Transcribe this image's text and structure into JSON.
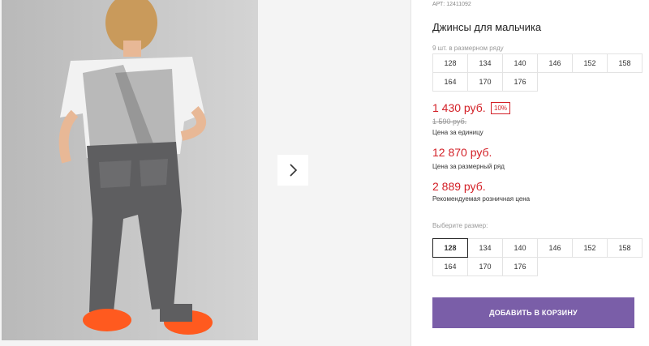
{
  "gallery": {
    "photo_alt": "boy in grey jeans",
    "next_icon": "chevron-right-icon"
  },
  "product": {
    "sku": "АРТ: 12411092",
    "title": "Джинсы для мальчика"
  },
  "size_row": {
    "label": "9 шт. в размерном ряду",
    "sizes": [
      "128",
      "134",
      "140",
      "146",
      "152",
      "158",
      "164",
      "170",
      "176"
    ]
  },
  "pricing": {
    "unit_price": "1 430 руб.",
    "discount": "10%",
    "old_price": "1 590 руб.",
    "unit_caption": "Цена за единицу",
    "row_price": "12 870 руб.",
    "row_caption": "Цена за размерный ряд",
    "retail_price": "2 889 руб.",
    "retail_caption": "Рекомендуемая розничная цена"
  },
  "size_select": {
    "label": "Выберите размер:",
    "sizes": [
      "128",
      "134",
      "140",
      "146",
      "152",
      "158",
      "164",
      "170",
      "176"
    ],
    "selected": "128"
  },
  "cart": {
    "button_label": "ДОБАВИТЬ В КОРЗИНУ"
  },
  "colors": {
    "accent": "#7a5ea8",
    "price": "#d32027"
  }
}
